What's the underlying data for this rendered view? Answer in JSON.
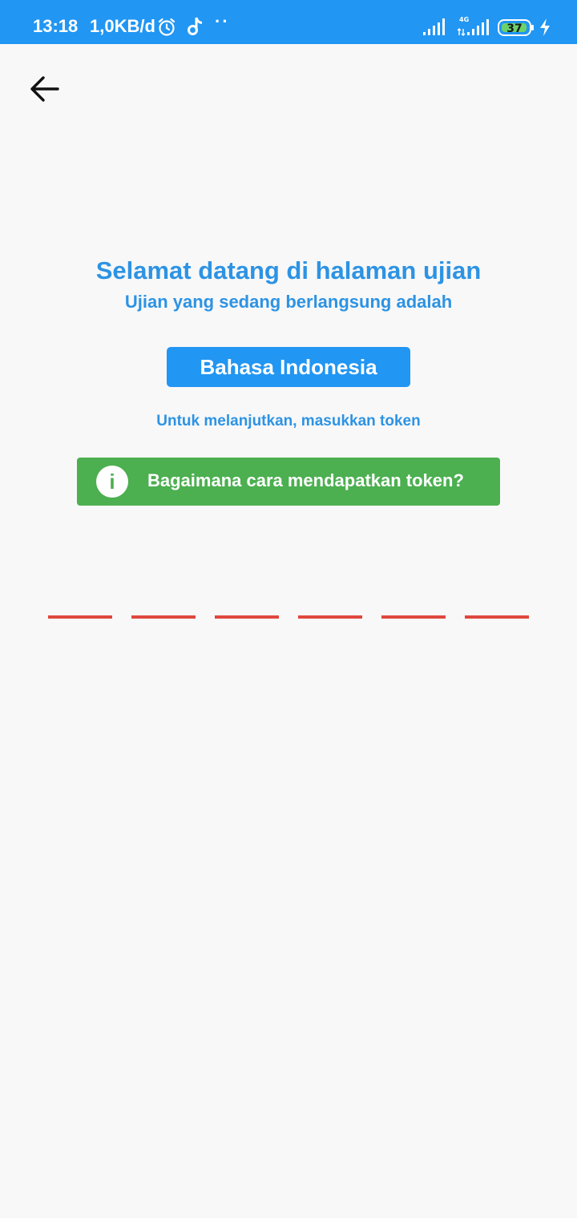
{
  "status_bar": {
    "time": "13:18",
    "net_speed": "1,0KB/d",
    "dots": "··",
    "network_type": "4G",
    "battery_level": "37",
    "icons": [
      "alarm-icon",
      "tiktok-icon",
      "signal-icon",
      "signal-4g-icon",
      "battery-icon",
      "charging-icon"
    ]
  },
  "header": {
    "back_icon": "arrow-left-icon"
  },
  "main": {
    "title": "Selamat datang di halaman ujian",
    "subtitle": "Ujian yang sedang berlangsung adalah",
    "subject_button": "Bahasa Indonesia",
    "token_hint": "Untuk melanjutkan, masukkan token",
    "help_button": {
      "icon_glyph": "i",
      "label": "Bagaimana cara mendapatkan token?"
    },
    "token_slots": [
      "",
      "",
      "",
      "",
      "",
      ""
    ]
  },
  "colors": {
    "status_bar": "#2196f3",
    "accent_text": "#2d93e3",
    "primary_button": "#2196f3",
    "help_button": "#4caf50",
    "token_underline": "#e0473e",
    "background": "#f8f8f9"
  }
}
